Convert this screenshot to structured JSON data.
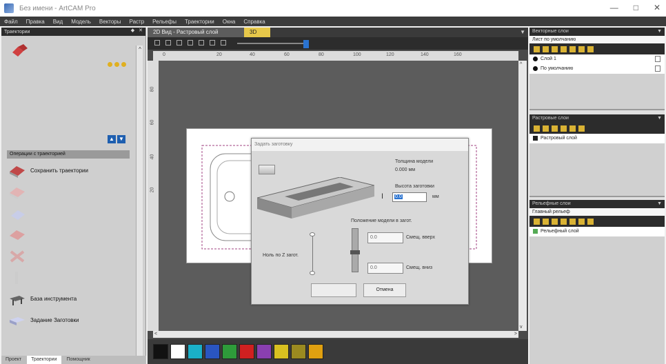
{
  "window": {
    "title": "Без имени - ArtCAM Pro",
    "controls": [
      "—",
      "□",
      "✕"
    ]
  },
  "menu": [
    "Файл",
    "Правка",
    "Вид",
    "Модель",
    "Векторы",
    "Растр",
    "Рельефы",
    "Траектории",
    "Окна",
    "Справка"
  ],
  "left_panel": {
    "title": "Траектории",
    "ops_header": "Операции с траекторией",
    "ops": [
      {
        "label": "Сохранить траектории",
        "faded": false,
        "icon": "save-toolpath-icon"
      },
      {
        "label": "",
        "faded": true,
        "icon": "toolpath-icon-2"
      },
      {
        "label": "",
        "faded": true,
        "icon": "toolpath-icon-3"
      },
      {
        "label": "",
        "faded": true,
        "icon": "toolpath-icon-4"
      },
      {
        "label": "",
        "faded": true,
        "icon": "toolpath-icon-5"
      },
      {
        "label": "",
        "faded": true,
        "icon": "toolpath-icon-6"
      },
      {
        "label": "База инструмента",
        "faded": false,
        "icon": "tool-database-icon"
      },
      {
        "label": "Задание Заготовки",
        "faded": false,
        "icon": "set-material-icon"
      }
    ],
    "bottom_tabs": [
      "Проект",
      "Траектории",
      "Помощник"
    ]
  },
  "center": {
    "tabs": [
      "2D Вид - Растровый слой",
      "3D вид"
    ],
    "ruler_h": [
      "0",
      "20",
      "40",
      "60",
      "80",
      "100",
      "120",
      "140",
      "160"
    ],
    "ruler_v": [
      "80",
      "60",
      "40",
      "20"
    ]
  },
  "dialog": {
    "title": "Задать заготовку",
    "thickness_label": "Толщина модели",
    "thickness_value": "0.000 мм",
    "height_label": "Высота заготовки",
    "height_value": "0.0",
    "height_unit": "мм",
    "position_label": "Положение модели в загот.",
    "z_label": "Ноль по Z загот.",
    "offset_top_value": "0.0",
    "offset_top_label": "Смещ. вверх",
    "offset_bottom_value": "0.0",
    "offset_bottom_label": "Смещ. вниз",
    "cancel_label": "Отмена"
  },
  "palette": [
    "#111111",
    "#ffffff",
    "#1ab0c8",
    "#2a55c0",
    "#2e9b3a",
    "#d02020",
    "#8a3fb0",
    "#d8c020",
    "#9b8a20",
    "#e0a010"
  ],
  "right_panels": {
    "vector": {
      "title": "Векторные слои",
      "sub": "Лист по умолчанию",
      "items": [
        "Слой 1",
        "По умолчанию"
      ]
    },
    "raster": {
      "title": "Растровые слои",
      "items": [
        "Растровый слой"
      ]
    },
    "relief": {
      "title": "Рельефные слои",
      "sub": "Главный рельеф",
      "items": [
        "Рельефный слой"
      ]
    }
  }
}
